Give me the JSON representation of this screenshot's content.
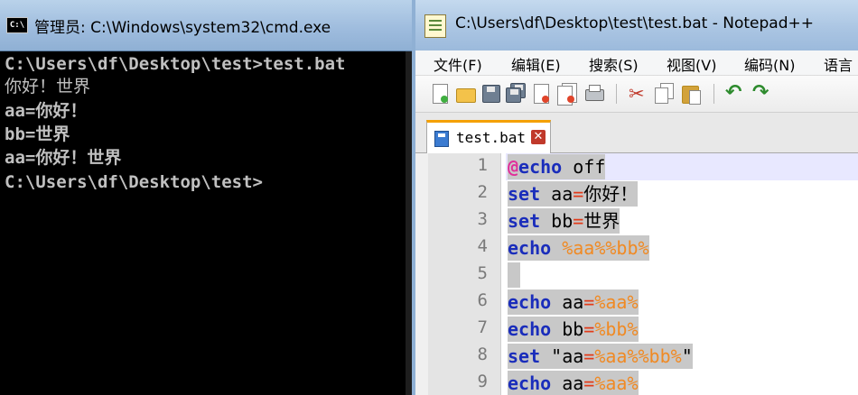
{
  "cmd": {
    "title": "管理员: C:\\Windows\\system32\\cmd.exe",
    "icon_label": "C:\\",
    "lines": [
      "C:\\Users\\df\\Desktop\\test>test.bat",
      "你好！世界",
      "aa=你好！",
      "bb=世界",
      "aa=你好！世界",
      "C:\\Users\\df\\Desktop\\test>"
    ]
  },
  "notepad": {
    "title": "C:\\Users\\df\\Desktop\\test\\test.bat - Notepad++",
    "menu": [
      "文件(F)",
      "编辑(E)",
      "搜索(S)",
      "视图(V)",
      "编码(N)",
      "语言"
    ],
    "toolbar_icons": [
      "new-file-icon",
      "open-file-icon",
      "save-icon",
      "save-all-icon",
      "close-icon",
      "close-all-icon",
      "print-icon",
      "cut-icon",
      "copy-icon",
      "paste-icon",
      "undo-icon",
      "redo-icon"
    ],
    "tab": {
      "label": "test.bat",
      "close_glyph": "✕"
    },
    "line_numbers": [
      "1",
      "2",
      "3",
      "4",
      "5",
      "6",
      "7",
      "8",
      "9"
    ],
    "code": {
      "l1": {
        "at": "@",
        "kw": "echo",
        "rest": " off"
      },
      "l2": {
        "kw": "set",
        "t1": " aa",
        "op": "=",
        "t2": "你好！"
      },
      "l3": {
        "kw": "set",
        "t1": " bb",
        "op": "=",
        "t2": "世界"
      },
      "l4": {
        "kw": "echo",
        "sp": " ",
        "v1": "%aa%",
        "v2": "%bb%"
      },
      "l6": {
        "kw": "echo",
        "t1": " aa",
        "op": "=",
        "v1": "%aa%"
      },
      "l7": {
        "kw": "echo",
        "t1": " bb",
        "op": "=",
        "v1": "%bb%"
      },
      "l8": {
        "kw": "set",
        "t1": " \"aa",
        "op": "=",
        "v1": "%aa%",
        "v2": "%bb%",
        "t2": "\""
      },
      "l9": {
        "kw": "echo",
        "t1": " aa",
        "op": "=",
        "v1": "%aa%"
      }
    }
  }
}
